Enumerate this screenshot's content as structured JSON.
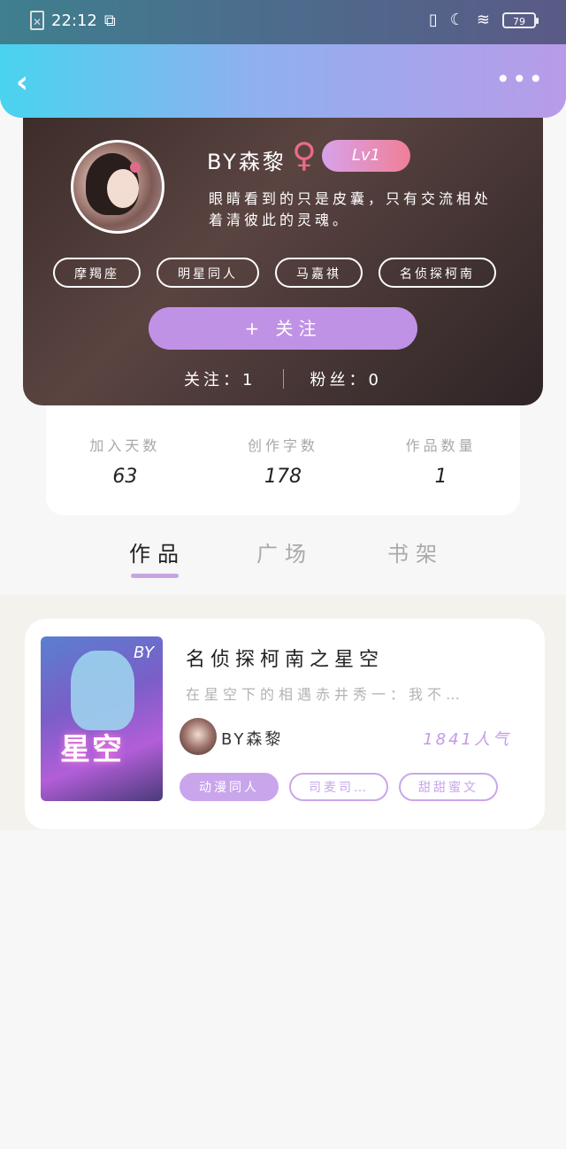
{
  "status_bar": {
    "time": "22:12",
    "battery": "79"
  },
  "header": {
    "back_icon": "chevron-left-icon",
    "more_icon": "more-dots-icon"
  },
  "profile": {
    "username": "BY森黎",
    "gender_icon": "female-icon",
    "level": "Lv1",
    "bio": "眼睛看到的只是皮囊，只有交流相处\n着清彼此的灵魂。",
    "tags": [
      "摩羯座",
      "明星同人",
      "马嘉祺",
      "名侦探柯南"
    ],
    "follow_label": "+ 关注",
    "following_label": "关注：1",
    "followers_label": "粉丝：0"
  },
  "stats": [
    {
      "label": "加入天数",
      "value": "63"
    },
    {
      "label": "创作字数",
      "value": "178"
    },
    {
      "label": "作品数量",
      "value": "1"
    }
  ],
  "tabs": [
    "作品",
    "广场",
    "书架"
  ],
  "work": {
    "cover_text": "星空",
    "cover_by": "BY",
    "title": "名侦探柯南之星空",
    "description": "在星空下的相遇赤井秀一：我不…",
    "author": "BY森黎",
    "popularity": "1841人气",
    "tags": [
      "动漫同人",
      "司麦司…",
      "甜甜蜜文"
    ]
  },
  "colors": {
    "accent": "#c092e6",
    "header_start": "#49d3ef",
    "header_end": "#b89be8"
  }
}
